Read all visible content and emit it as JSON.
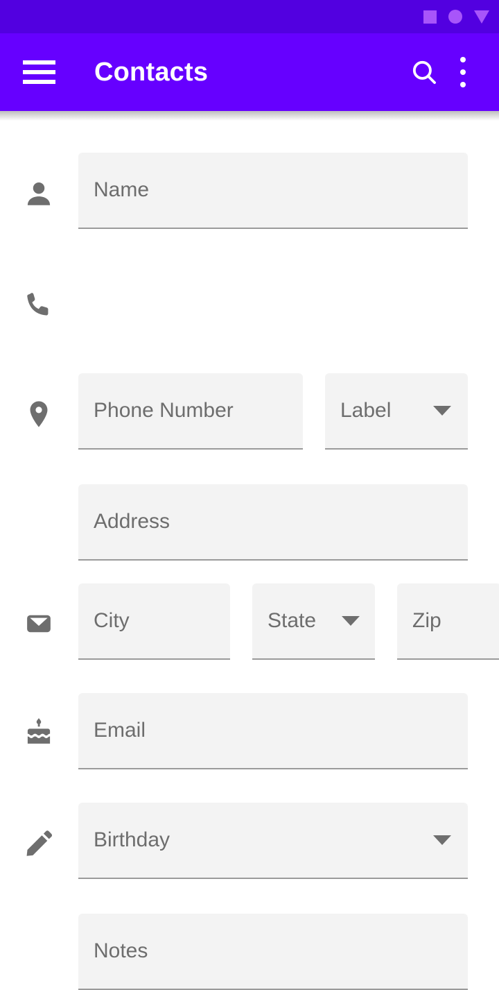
{
  "status_bar": {
    "icons": [
      {
        "name": "square-indicator-icon"
      },
      {
        "name": "circle-indicator-icon"
      },
      {
        "name": "triangle-indicator-icon"
      }
    ],
    "background_color": "#5200e0",
    "icon_color": "#a855fa"
  },
  "app_bar": {
    "title": "Contacts",
    "menu_icon": "hamburger-menu-icon",
    "search_icon": "search-icon",
    "overflow_icon": "overflow-menu-icon",
    "background_color": "#6600ff",
    "text_color": "#ffffff"
  },
  "form": {
    "field_background": "#f3f3f3",
    "field_underline": "#9a9a9a",
    "placeholder_color": "#6d6d6d",
    "icon_color": "#6e6e6e",
    "rows": [
      {
        "icon": "person-icon",
        "fields": [
          {
            "name": "name-input",
            "placeholder": "Name",
            "value": "",
            "type": "text"
          }
        ]
      },
      {
        "icon": "phone-icon",
        "fields": [
          {
            "name": "phone-number-input",
            "placeholder": "Phone Number",
            "value": "",
            "type": "text"
          },
          {
            "name": "phone-label-dropdown",
            "placeholder": "Label",
            "value": "",
            "type": "dropdown"
          }
        ]
      },
      {
        "icon": "location-pin-icon",
        "fields": [
          {
            "name": "address-input",
            "placeholder": "Address",
            "value": "",
            "type": "text"
          }
        ]
      },
      {
        "icon": "",
        "fields": [
          {
            "name": "city-input",
            "placeholder": "City",
            "value": "",
            "type": "text"
          },
          {
            "name": "state-dropdown",
            "placeholder": "State",
            "value": "",
            "type": "dropdown"
          },
          {
            "name": "zip-input",
            "placeholder": "Zip",
            "value": "",
            "type": "text"
          }
        ]
      },
      {
        "icon": "envelope-icon",
        "fields": [
          {
            "name": "email-input",
            "placeholder": "Email",
            "value": "",
            "type": "text"
          }
        ]
      },
      {
        "icon": "birthday-cake-icon",
        "fields": [
          {
            "name": "birthday-dropdown",
            "placeholder": "Birthday",
            "value": "",
            "type": "dropdown"
          }
        ]
      },
      {
        "icon": "pencil-icon",
        "fields": [
          {
            "name": "notes-input",
            "placeholder": "Notes",
            "value": "",
            "type": "text"
          }
        ]
      }
    ]
  }
}
